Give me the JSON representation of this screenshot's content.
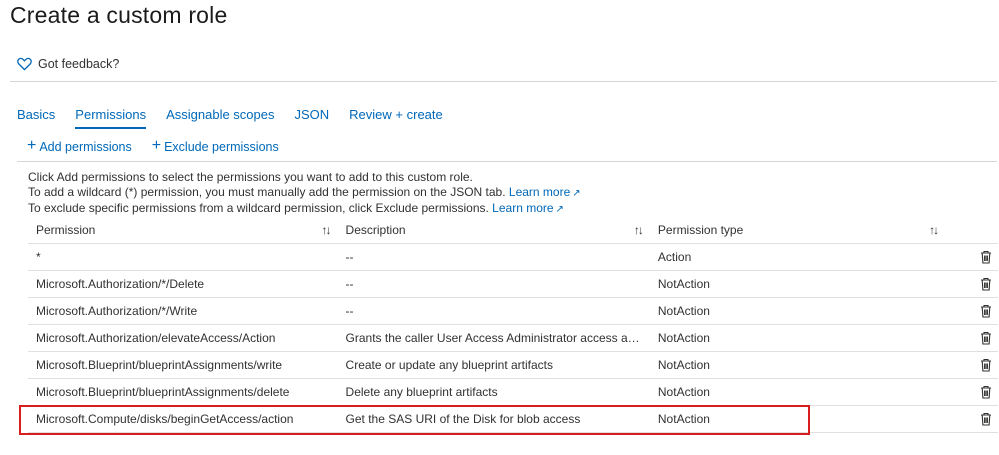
{
  "page": {
    "title": "Create a custom role"
  },
  "feedback": {
    "label": "Got feedback?"
  },
  "tabs": [
    {
      "label": "Basics"
    },
    {
      "label": "Permissions"
    },
    {
      "label": "Assignable scopes"
    },
    {
      "label": "JSON"
    },
    {
      "label": "Review + create"
    }
  ],
  "toolbar": {
    "add_label": "Add permissions",
    "exclude_label": "Exclude permissions"
  },
  "info": {
    "line1": "Click Add permissions to select the permissions you want to add to this custom role.",
    "line2": "To add a wildcard (*) permission, you must manually add the permission on the JSON tab.",
    "line3": "To exclude specific permissions from a wildcard permission, click Exclude permissions.",
    "learn_more": "Learn more"
  },
  "table": {
    "headers": {
      "permission": "Permission",
      "description": "Description",
      "type": "Permission type"
    },
    "rows": [
      {
        "permission": "*",
        "description": "--",
        "type": "Action"
      },
      {
        "permission": "Microsoft.Authorization/*/Delete",
        "description": "--",
        "type": "NotAction"
      },
      {
        "permission": "Microsoft.Authorization/*/Write",
        "description": "--",
        "type": "NotAction"
      },
      {
        "permission": "Microsoft.Authorization/elevateAccess/Action",
        "description": "Grants the caller User Access Administrator access at the te...",
        "type": "NotAction"
      },
      {
        "permission": "Microsoft.Blueprint/blueprintAssignments/write",
        "description": "Create or update any blueprint artifacts",
        "type": "NotAction"
      },
      {
        "permission": "Microsoft.Blueprint/blueprintAssignments/delete",
        "description": "Delete any blueprint artifacts",
        "type": "NotAction"
      },
      {
        "permission": "Microsoft.Compute/disks/beginGetAccess/action",
        "description": "Get the SAS URI of the Disk for blob access",
        "type": "NotAction"
      }
    ]
  },
  "colors": {
    "accent": "#0068b8",
    "highlight": "#d81d1d"
  }
}
